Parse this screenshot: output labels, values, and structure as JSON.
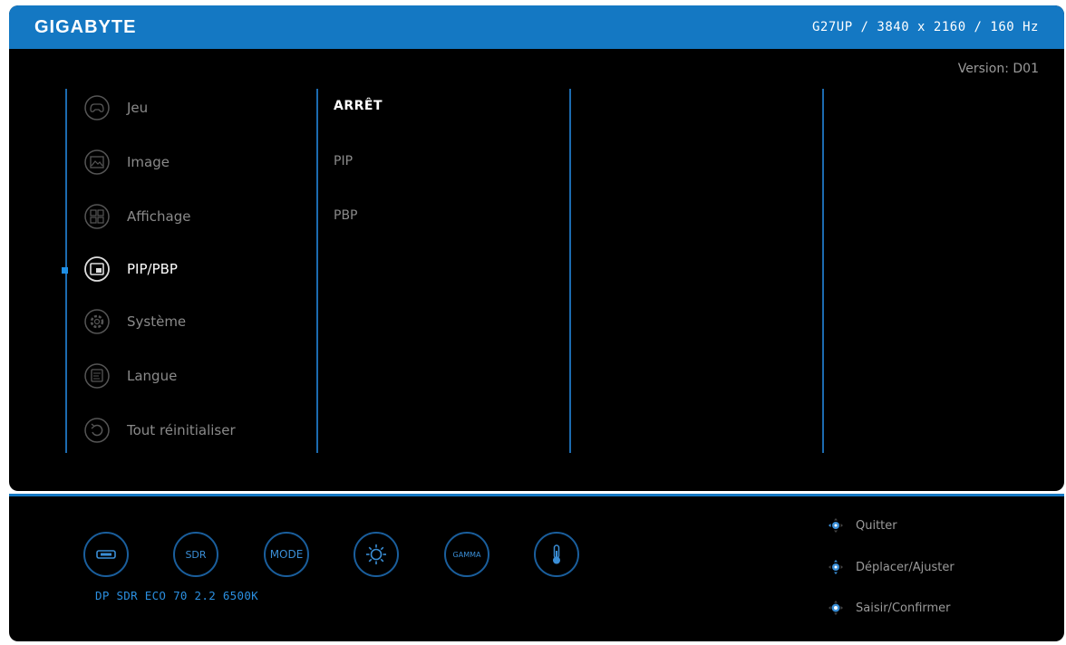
{
  "header": {
    "logo": "GIGABYTE",
    "model": "G27UP  /  3840 x 2160 / 160 Hz"
  },
  "version": "Version: D01",
  "menu": [
    {
      "label": "Jeu",
      "icon": "gamepad-icon"
    },
    {
      "label": "Image",
      "icon": "image-icon"
    },
    {
      "label": "Affichage",
      "icon": "display-icon"
    },
    {
      "label": "PIP/PBP",
      "icon": "pip-icon",
      "active": true
    },
    {
      "label": "Système",
      "icon": "gear-icon"
    },
    {
      "label": "Langue",
      "icon": "language-icon"
    },
    {
      "label": "Tout réinitialiser",
      "icon": "reset-icon"
    }
  ],
  "submenu": [
    {
      "label": "ARRÊT",
      "active": true
    },
    {
      "label": "PIP"
    },
    {
      "label": "PBP"
    }
  ],
  "quick": {
    "buttons": [
      {
        "name": "input-icon"
      },
      {
        "label": "SDR"
      },
      {
        "label": "MODE"
      },
      {
        "name": "brightness-icon"
      },
      {
        "label": "GAMMA"
      },
      {
        "name": "temperature-icon"
      }
    ],
    "status": "DP SDR ECO 70 2.2 6500K"
  },
  "hints": [
    {
      "label": "Quitter",
      "icon": "joystick-left-icon"
    },
    {
      "label": "Déplacer/Ajuster",
      "icon": "joystick-move-icon"
    },
    {
      "label": "Saisir/Confirmer",
      "icon": "joystick-press-icon"
    }
  ],
  "colors": {
    "accent": "#1478c3",
    "background": "#000000",
    "active_text": "#ffffff",
    "inactive_text": "#8a8a8a",
    "status_text": "#2b8fe0"
  }
}
